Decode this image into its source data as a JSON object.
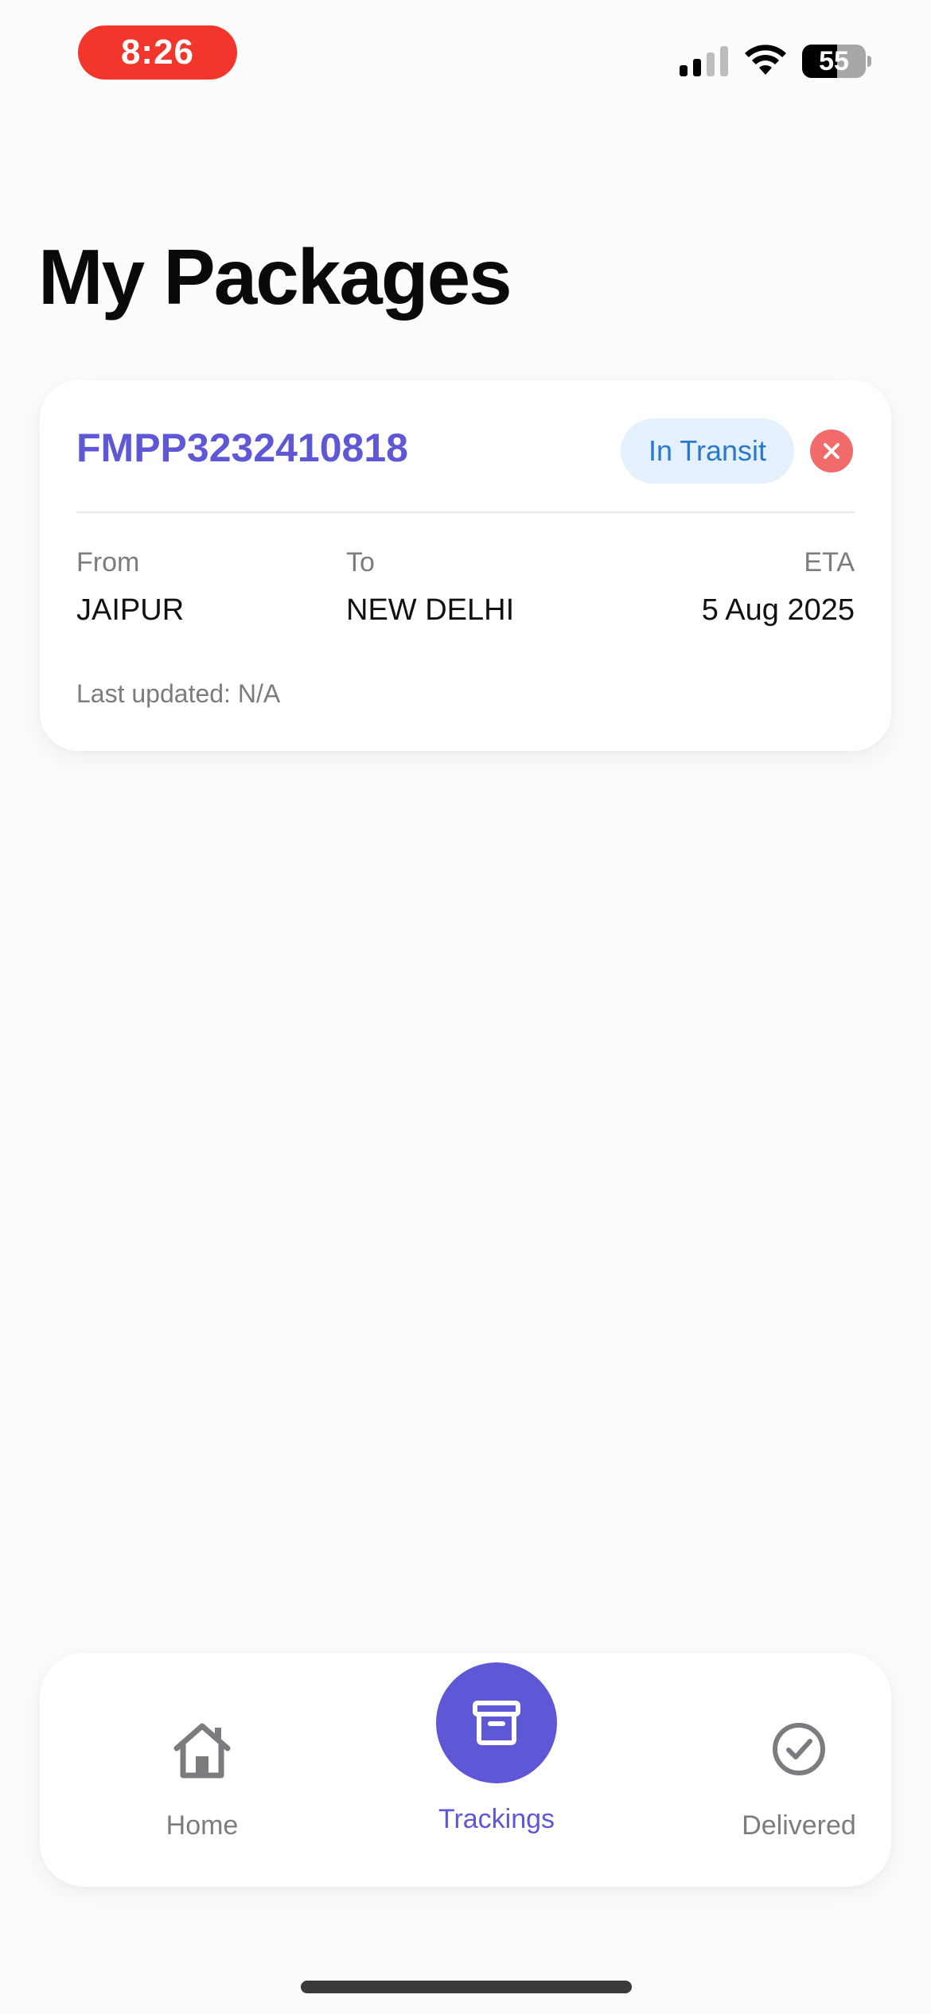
{
  "status_bar": {
    "time": "8:26",
    "battery_level": "55"
  },
  "header": {
    "title": "My Packages"
  },
  "packages": [
    {
      "tracking_number": "FMPP3232410818",
      "status": "In Transit",
      "from_label": "From",
      "from_value": "JAIPUR",
      "to_label": "To",
      "to_value": "NEW DELHI",
      "eta_label": "ETA",
      "eta_value": "5 Aug 2025",
      "last_updated": "Last updated: N/A"
    }
  ],
  "tab_bar": {
    "items": [
      {
        "label": "Home",
        "icon": "home-icon",
        "active": false
      },
      {
        "label": "Trackings",
        "icon": "archive-box-icon",
        "active": true
      },
      {
        "label": "Delivered",
        "icon": "check-circle-icon",
        "active": false
      }
    ]
  },
  "colors": {
    "accent": "#5e58d6",
    "status_badge_bg": "#e4f1fc",
    "status_badge_text": "#2878d0",
    "remove": "#f06b6a",
    "recording_pill": "#f2362b"
  }
}
